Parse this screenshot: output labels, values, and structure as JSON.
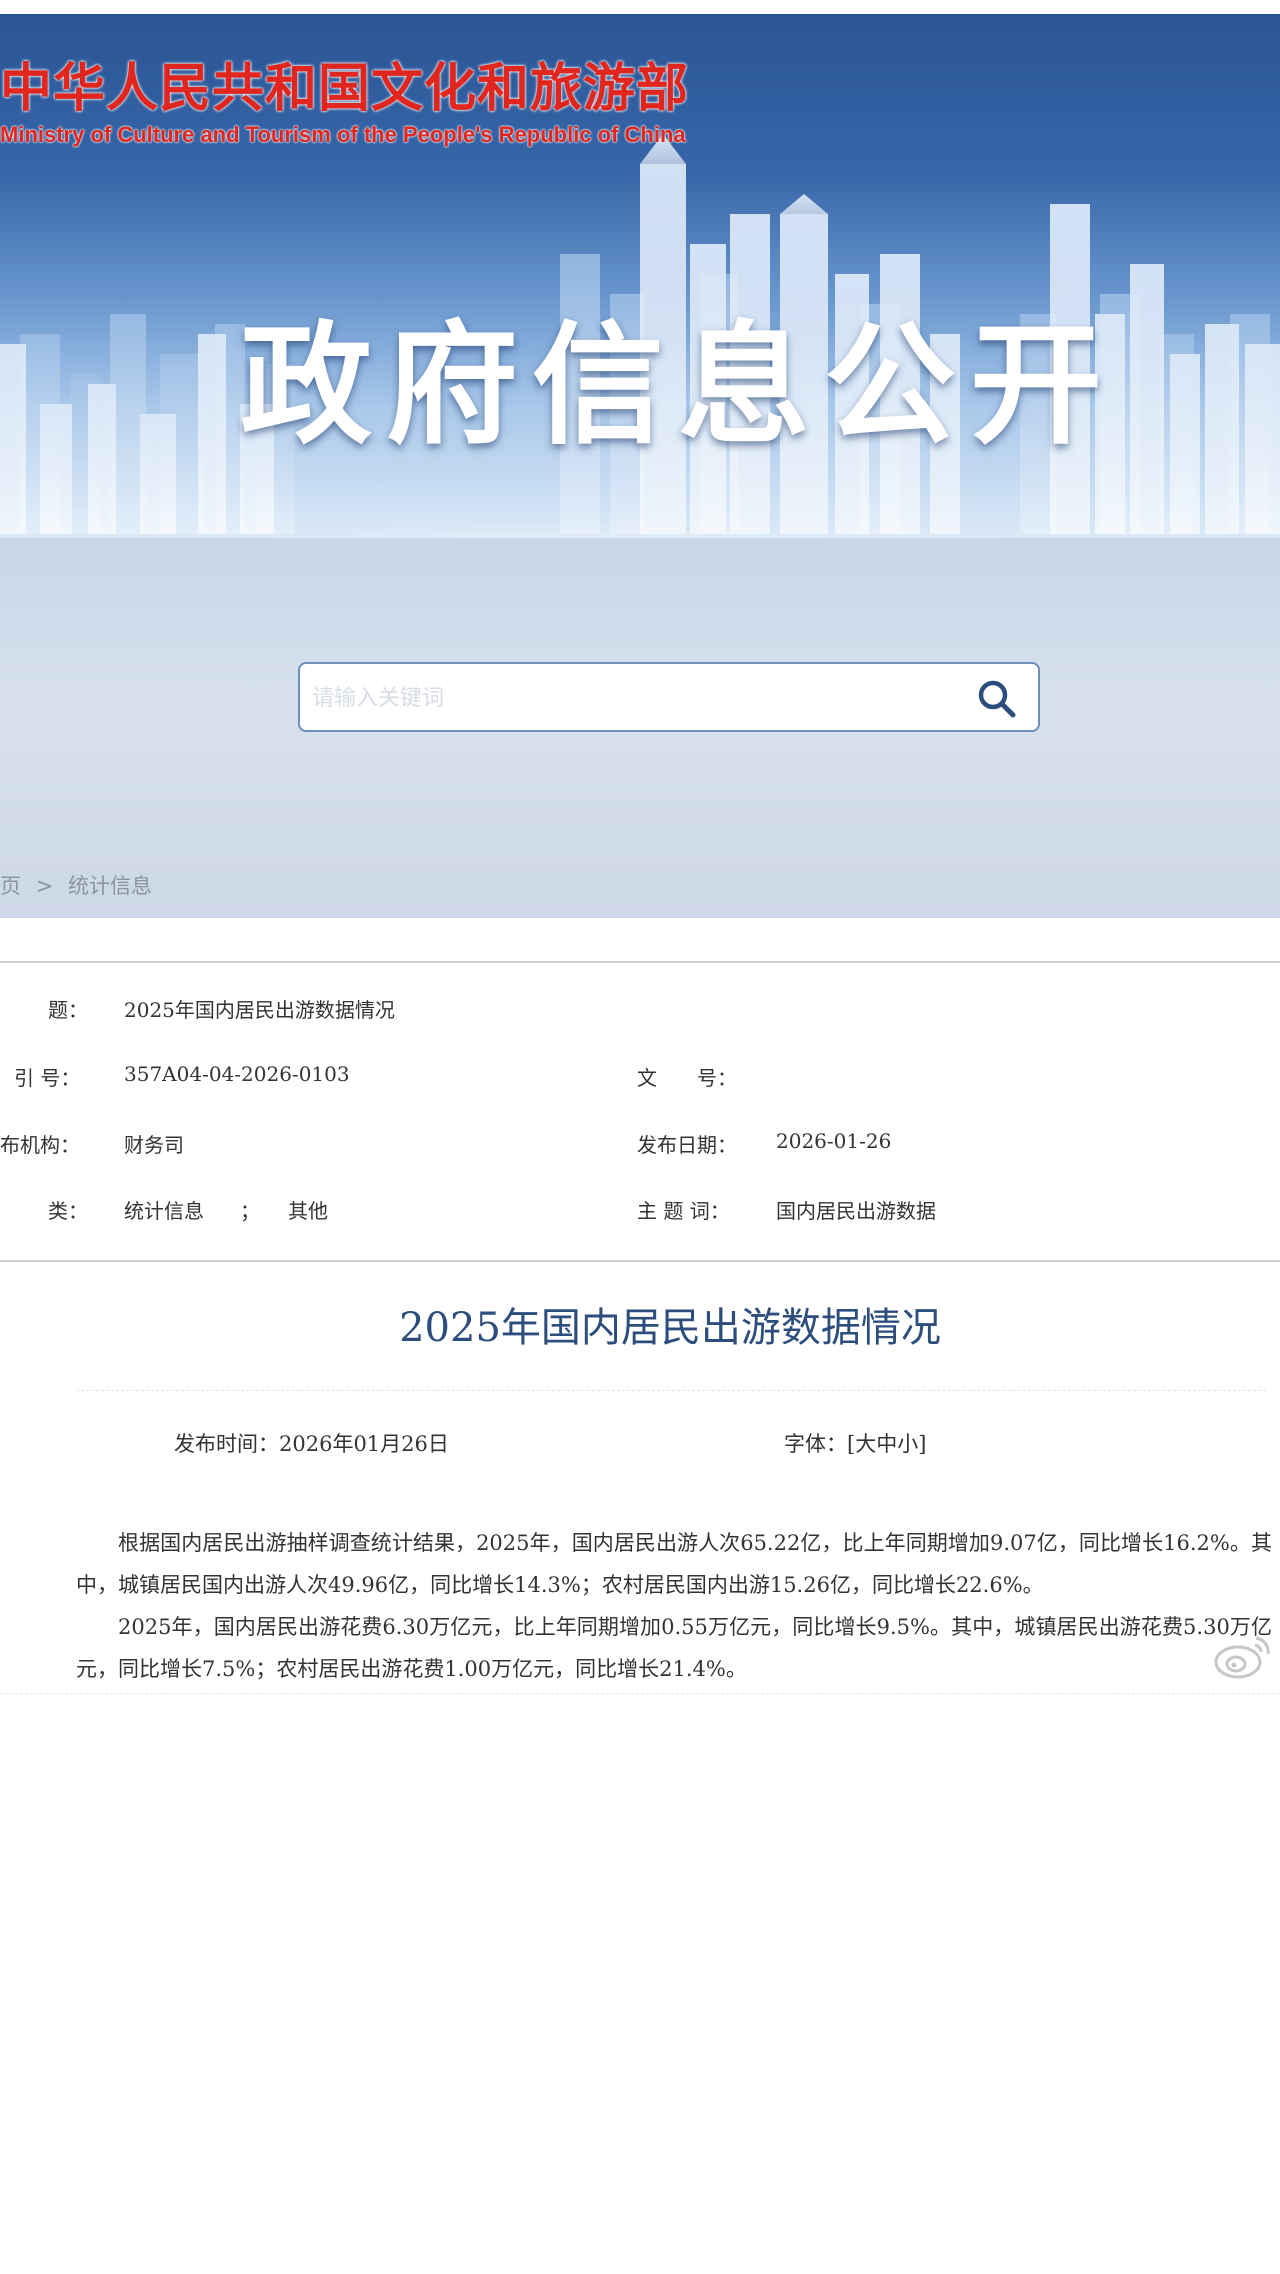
{
  "header": {
    "logo_cn": "中华人民共和国文化和旅游部",
    "logo_en": "Ministry of Culture and Tourism of the People's Republic of China",
    "banner_title": "政府信息公开"
  },
  "search": {
    "placeholder": "请输入关键词",
    "value": ""
  },
  "breadcrumb": {
    "home": "页",
    "separator": ">",
    "current": "统计信息"
  },
  "info": {
    "title_label": "题：",
    "title_value": "2025年国内居民出游数据情况",
    "index_label": "引 号：",
    "index_value": "357A04-04-2026-0103",
    "doc_no_label": "文　　号：",
    "doc_no_value": "",
    "org_label": "布机构：",
    "org_value": "财务司",
    "date_label": "发布日期：",
    "date_value": "2026-01-26",
    "category_label": "类：",
    "category_value1": "统计信息",
    "category_sep": "；",
    "category_value2": "其他",
    "subject_label": "主 题 词：",
    "subject_value": "国内居民出游数据"
  },
  "article": {
    "title": "2025年国内居民出游数据情况",
    "publish_time": "发布时间：2026年01月26日",
    "font_label": "字体：",
    "font_open": "[",
    "font_large": "大",
    "font_medium": "中",
    "font_small": "小",
    "font_close": "]",
    "paragraphs": [
      "根据国内居民出游抽样调查统计结果，2025年，国内居民出游人次65.22亿，比上年同期增加9.07亿，同比增长16.2%。其中，城镇居民国内出游人次49.96亿，同比增长14.3%；农村居民国内出游15.26亿，同比增长22.6%。",
      "2025年，国内居民出游花费6.30万亿元，比上年同期增加0.55万亿元，同比增长9.5%。其中，城镇居民出游花费5.30万亿元，同比增长7.5%；农村居民出游花费1.00万亿元，同比增长21.4%。"
    ]
  },
  "colors": {
    "brand_red": "#e0261f",
    "title_blue": "#2d4e7c",
    "banner_blue": "#2a5595"
  },
  "icons": {
    "search": "search-icon",
    "watermark": "weibo-icon"
  }
}
